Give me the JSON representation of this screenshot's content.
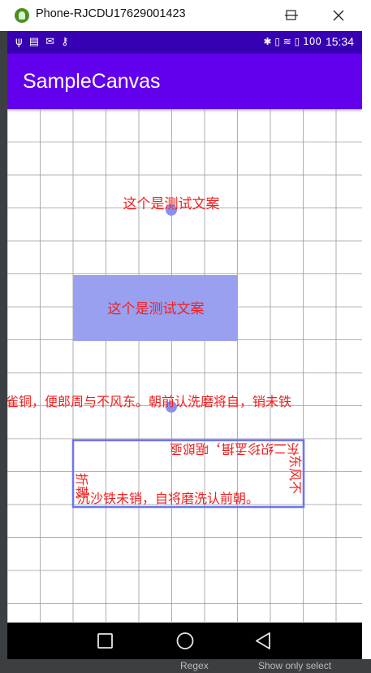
{
  "window": {
    "title": "Phone-RJCDU17629001423",
    "minimize": "—",
    "maximize": "☐",
    "close": "✕"
  },
  "status_bar": {
    "left_icons": "ψ ▤ ✉ ⚷",
    "right_icons": "✱ ▯ ≋ ▯ 100",
    "time": "15:34"
  },
  "app_bar": {
    "title": "SampleCanvas"
  },
  "canvas": {
    "text_top": "这个是测试文案",
    "text_rect": "这个是测试文案",
    "text_line": "雀铜，便郎周与不风东。朝前认洗磨将自，销未铁",
    "box_top": "东二织珍孟揖，啹郎亟",
    "box_right": "东风不",
    "box_left": "折戟",
    "box_bottom": "沉沙铁未销，自将磨洗认前朝。",
    "colors": {
      "text": "#f02020",
      "rect_fill": "#9aa0f0",
      "dot": "#8a90f0",
      "box_stroke": "#6c74f0",
      "grid": "#9a9a9a"
    }
  },
  "nav_bar": {
    "recents": "recents",
    "home": "home",
    "back": "back"
  },
  "ide": {
    "regex_label": "Regex",
    "filter_label": "Show only select"
  }
}
